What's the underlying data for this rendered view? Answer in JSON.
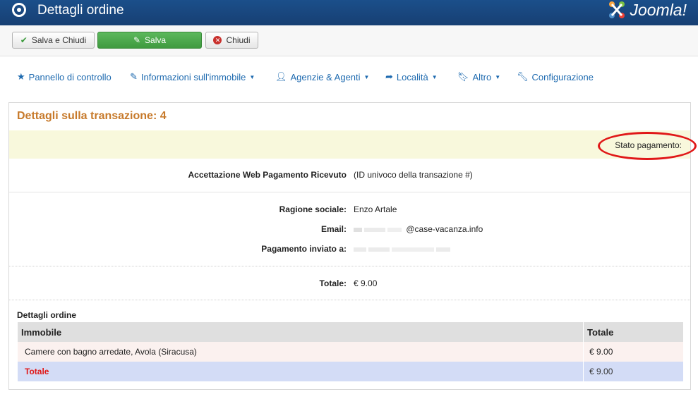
{
  "header": {
    "title": "Dettagli ordine",
    "brand": "Joomla!"
  },
  "toolbar": {
    "save_close_label": "Salva e Chiudi",
    "save_label": "Salva",
    "close_label": "Chiudi"
  },
  "nav": {
    "items": [
      {
        "label": "Pannello di controllo",
        "icon": "star-icon"
      },
      {
        "label": "Informazioni sull'immobile",
        "icon": "edit-icon"
      },
      {
        "label": "Agenzie & Agenti",
        "icon": "user-icon"
      },
      {
        "label": "Località",
        "icon": "share-icon"
      },
      {
        "label": "Altro",
        "icon": "bookmark-icon"
      },
      {
        "label": "Configurazione",
        "icon": "wrench-icon"
      }
    ]
  },
  "transaction": {
    "title": "Dettagli sulla transazione: 4",
    "payment_status_label": "Stato pagamento:",
    "accept_label": "Accettazione Web Pagamento Ricevuto",
    "accept_value": "(ID univoco della transazione #)",
    "company_label": "Ragione sociale:",
    "company_value": "Enzo Artale",
    "email_label": "Email:",
    "email_value": "@case-vacanza.info",
    "payment_sent_label": "Pagamento inviato a:",
    "total_label": "Totale:",
    "total_value": "€ 9.00"
  },
  "order": {
    "title": "Dettagli ordine",
    "columns": [
      "Immobile",
      "Totale"
    ],
    "rows": [
      {
        "property": "Camere con bagno arredate, Avola (Siracusa)",
        "total": "€  9.00"
      }
    ],
    "total_label": "Totale",
    "total_value": "€ 9.00"
  },
  "colors": {
    "header_bg": "#173f73",
    "accent_link": "#1f6bb0",
    "title_orange": "#c77a2b",
    "highlight_red": "#e01818",
    "save_green": "#4cae4c"
  }
}
